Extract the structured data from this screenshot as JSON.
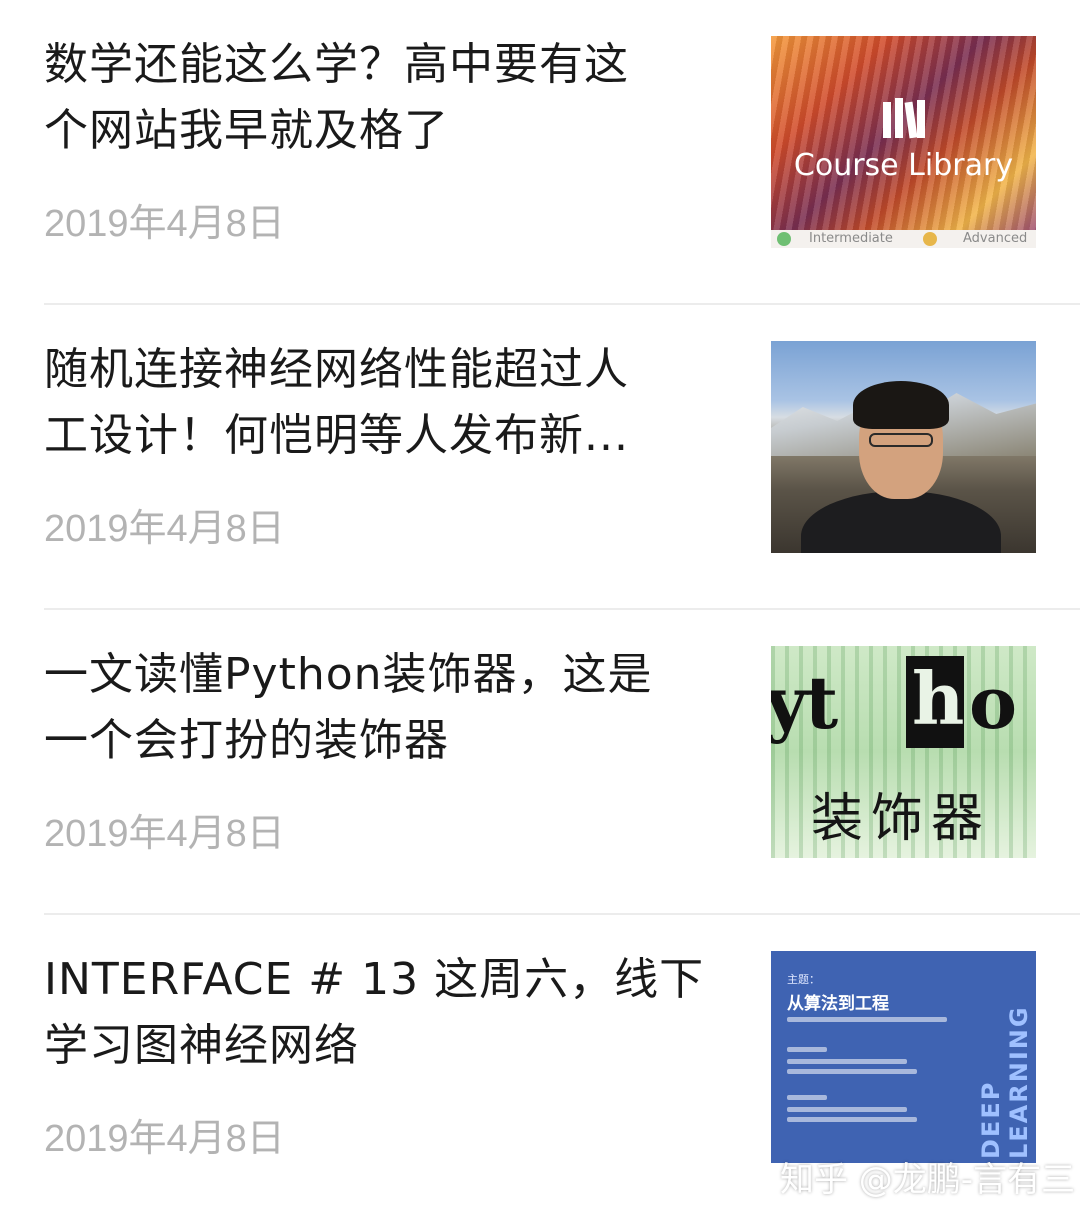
{
  "articles": [
    {
      "title_line1": "数学还能这么学？高中要有这",
      "title_line2": "个网站我早就及格了",
      "date": "2019年4月8日",
      "thumb": {
        "text": "Course Library",
        "levels": [
          "Intermediate",
          "Advanced"
        ]
      }
    },
    {
      "title_line1": "随机连接神经网络性能超过人",
      "title_line2": "工设计！何恺明等人发布新...",
      "date": "2019年4月8日"
    },
    {
      "title_line1": "一文读懂Python装饰器，这是",
      "title_line2": "一个会打扮的装饰器",
      "date": "2019年4月8日",
      "thumb": {
        "word_left": "yt",
        "word_h": "h",
        "word_right": "o",
        "cn": "装饰器"
      }
    },
    {
      "title_line1": "INTERFACE # 13 这周六，线下",
      "title_line2": "学习图神经网络",
      "date": "2019年4月8日",
      "thumb": {
        "topic": "主题：",
        "heading": "从算法到工程",
        "vertical": "DEEP LEARNING"
      }
    }
  ],
  "watermark": "知乎 @龙鹏-言有三",
  "colors": {
    "title": "#1a1a1a",
    "date": "#b3b3b3",
    "divider": "#ececec",
    "poster_blue": "#3f63b2"
  }
}
